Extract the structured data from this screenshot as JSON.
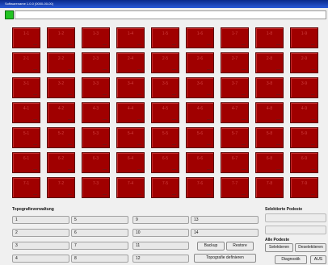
{
  "window": {
    "title": "Softwarename 1.0.0 (0000-00-00)"
  },
  "toolbar": {
    "status_color": "#22c422"
  },
  "grid": {
    "tile_color": "#a00000",
    "rows": [
      [
        "1-1",
        "1-2",
        "1-3",
        "1-4",
        "1-5",
        "1-6",
        "1-7",
        "1-8",
        "1-9"
      ],
      [
        "2-1",
        "2-2",
        "2-3",
        "2-4",
        "2-5",
        "2-6",
        "2-7",
        "2-8",
        "2-9"
      ],
      [
        "3-1",
        "3-2",
        "3-3",
        "3-4",
        "3-5",
        "3-6",
        "3-7",
        "3-8",
        "3-9"
      ],
      [
        "4-1",
        "4-2",
        "4-3",
        "4-4",
        "4-5",
        "4-6",
        "4-7",
        "4-8",
        "4-9"
      ],
      [
        "5-1",
        "5-2",
        "5-3",
        "5-4",
        "5-5",
        "5-6",
        "5-7",
        "5-8",
        "5-9"
      ],
      [
        "6-1",
        "6-2",
        "6-3",
        "6-4",
        "6-5",
        "6-6",
        "6-7",
        "6-8",
        "6-9"
      ],
      [
        "7-1",
        "7-2",
        "7-3",
        "7-4",
        "7-5",
        "7-6",
        "7-7",
        "7-8",
        "7-9"
      ]
    ]
  },
  "topografie": {
    "title": "Topografieverwaltung",
    "buttons": [
      "1",
      "2",
      "3",
      "4",
      "5",
      "6",
      "7",
      "8",
      "9",
      "10",
      "11",
      "12",
      "13",
      "14"
    ],
    "backup_label": "Backup",
    "restore_label": "Restore",
    "define_label": "Topografie definieren"
  },
  "selected_podests": {
    "title": "Selektierte Podeste",
    "enter_target_label": "",
    "target_equals_actual_label": ""
  },
  "all_podests": {
    "title": "Alle Podeste",
    "select_label": "Selektieren",
    "deselect_label": "Deselektieren",
    "diagnostic_label": "Diagnostik",
    "off_label": "AUS"
  }
}
